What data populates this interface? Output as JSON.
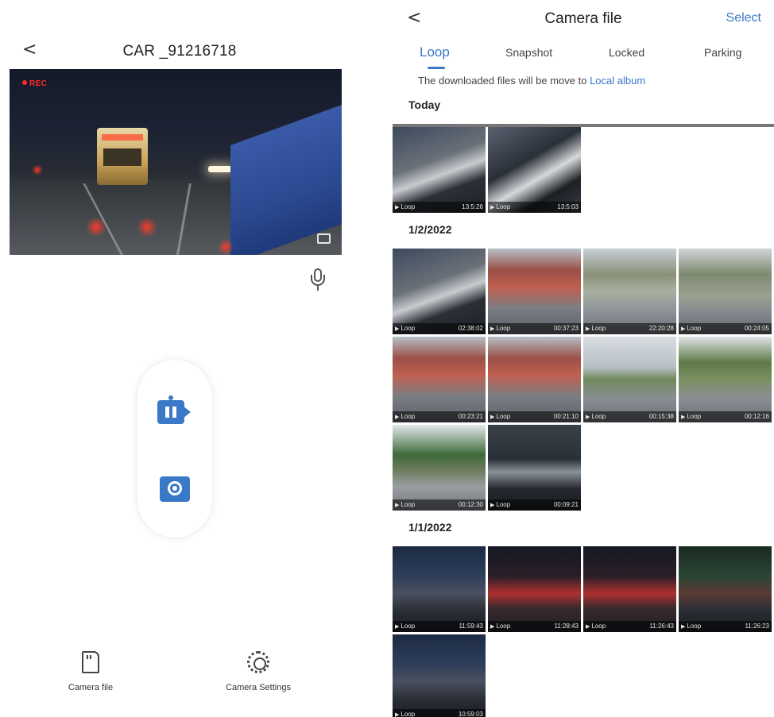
{
  "left_screen": {
    "device_title": "CAR _91216718",
    "back_glyph": "<",
    "rec_label": "REC",
    "bottom_actions": {
      "camera_file": "Camera file",
      "camera_settings": "Camera Settings"
    },
    "icons": [
      "chevron-left-icon",
      "snapshot-icon",
      "microphone-icon",
      "pause-record-icon",
      "capture-photo-icon",
      "sd-card-icon",
      "gear-icon"
    ]
  },
  "right_screen": {
    "title": "Camera file",
    "back_glyph": "<",
    "select_label": "Select",
    "tabs": [
      {
        "label": "Loop",
        "active": true
      },
      {
        "label": "Snapshot",
        "active": false
      },
      {
        "label": "Locked",
        "active": false
      },
      {
        "label": "Parking",
        "active": false
      }
    ],
    "notice_text": "The downloaded files will be move to",
    "notice_link": "Local album",
    "sections": [
      {
        "date": "Today",
        "items": [
          {
            "name": "Loop",
            "time": "13:5:26",
            "scene": "interior"
          },
          {
            "name": "Loop",
            "time": "13:5:03",
            "scene": "interior-dark"
          }
        ]
      },
      {
        "date": "1/2/2022",
        "items": [
          {
            "name": "Loop",
            "time": "02:38:02",
            "scene": "interior"
          },
          {
            "name": "Loop",
            "time": "00:37:23",
            "scene": "street-red"
          },
          {
            "name": "Loop",
            "time": "22:20:28",
            "scene": "street-day"
          },
          {
            "name": "Loop",
            "time": "00:24:05",
            "scene": "street-day2"
          },
          {
            "name": "Loop",
            "time": "00:23:21",
            "scene": "street-red"
          },
          {
            "name": "Loop",
            "time": "00:21:10",
            "scene": "street-red"
          },
          {
            "name": "Loop",
            "time": "00:15:38",
            "scene": "street-sky"
          },
          {
            "name": "Loop",
            "time": "00:12:16",
            "scene": "street-green"
          },
          {
            "name": "Loop",
            "time": "00:12:30",
            "scene": "street-tree"
          },
          {
            "name": "Loop",
            "time": "00:09:21",
            "scene": "garage"
          }
        ]
      },
      {
        "date": "1/1/2022",
        "items": [
          {
            "name": "Loop",
            "time": "11:59:43",
            "scene": "night-blue"
          },
          {
            "name": "Loop",
            "time": "11:28:43",
            "scene": "night-red"
          },
          {
            "name": "Loop",
            "time": "11:26:43",
            "scene": "night-red"
          },
          {
            "name": "Loop",
            "time": "11:26:23",
            "scene": "night-green"
          },
          {
            "name": "Loop",
            "time": "10:59:03",
            "scene": "night-blue"
          }
        ]
      }
    ]
  },
  "colors": {
    "accent": "#3a78c8",
    "rec_red": "#ff2a2a",
    "text": "#222222"
  }
}
